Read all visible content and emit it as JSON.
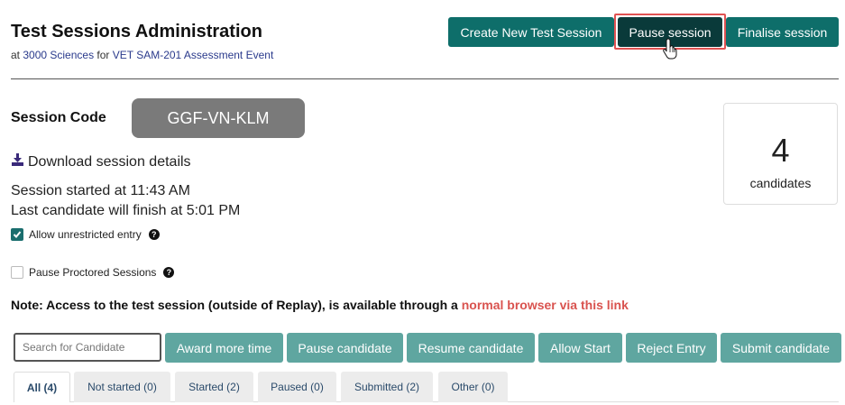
{
  "header": {
    "title": "Test Sessions Administration",
    "subtitle_prefix": "at ",
    "org": "3000 Sciences",
    "subtitle_middle": " for ",
    "event": "VET SAM-201 Assessment Event"
  },
  "toolbar": {
    "create_label": "Create New Test Session",
    "pause_label": "Pause session",
    "finalise_label": "Finalise session"
  },
  "session": {
    "code_label": "Session Code",
    "code": "GGF-VN-KLM",
    "download_label": "Download session details",
    "started": "Session started at 11:43 AM",
    "finish": "Last candidate will finish at 5:01 PM",
    "allow_unrestricted_label": "Allow unrestricted entry",
    "allow_unrestricted_checked": true,
    "pause_proctored_label": "Pause Proctored Sessions",
    "pause_proctored_checked": false
  },
  "candidates": {
    "count": "4",
    "label": "candidates"
  },
  "note": {
    "text": "Note: Access to the test session (outside of Replay), is available through a ",
    "link": "normal browser via this link"
  },
  "actions": {
    "search_placeholder": "Search for Candidate",
    "award": "Award more time",
    "pause_candidate": "Pause candidate",
    "resume": "Resume candidate",
    "allow_start": "Allow Start",
    "reject": "Reject Entry",
    "submit": "Submit candidate"
  },
  "tabs": [
    {
      "label": "All (4)",
      "active": true
    },
    {
      "label": "Not started (0)",
      "active": false
    },
    {
      "label": "Started (2)",
      "active": false
    },
    {
      "label": "Paused (0)",
      "active": false
    },
    {
      "label": "Submitted (2)",
      "active": false
    },
    {
      "label": "Other (0)",
      "active": false
    }
  ],
  "colors": {
    "primary": "#0e6e6a",
    "pause_active": "#0a3a3a",
    "action": "#5fa6a0",
    "highlight": "#e05252",
    "link": "#d9534f",
    "badge": "#7a7a7a"
  },
  "icons": {
    "download": "download-icon",
    "help": "question-circle-icon",
    "check": "check-icon",
    "cursor": "hand-pointer-icon"
  }
}
